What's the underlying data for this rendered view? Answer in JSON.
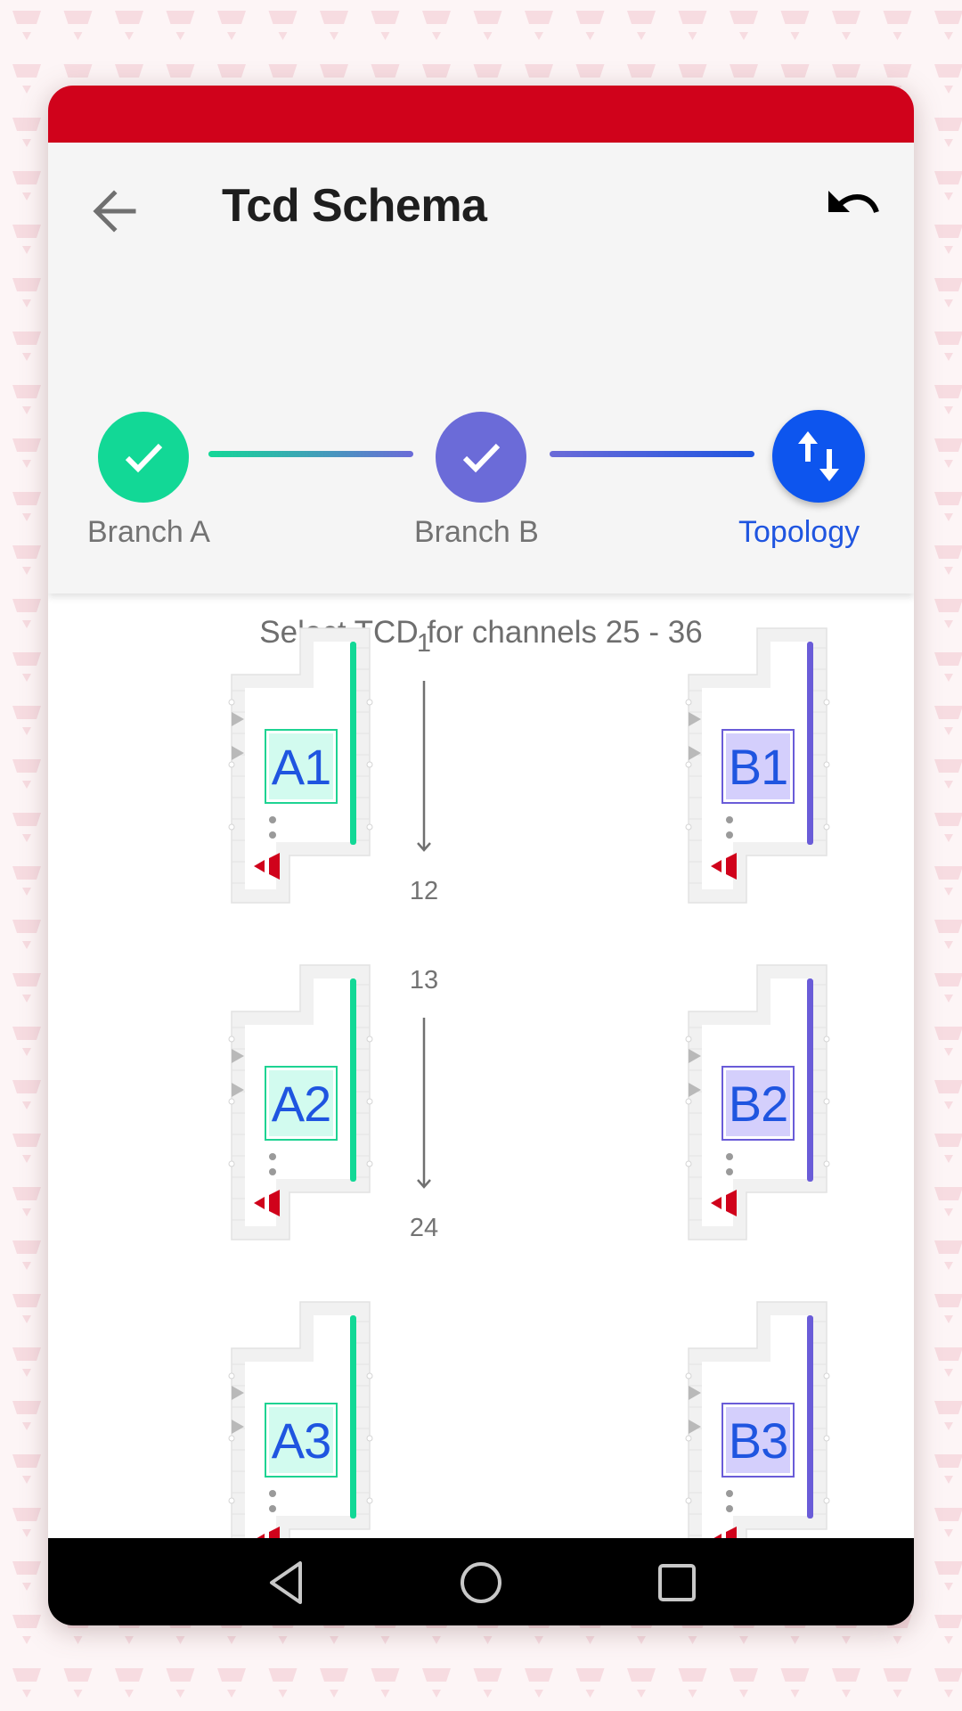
{
  "app": {
    "title": "Tcd Schema",
    "status_bar_color": "#d0021b"
  },
  "header": {
    "back_icon": "arrow-left-icon",
    "undo_icon": "undo-icon"
  },
  "stepper": {
    "steps": [
      {
        "label": "Branch A",
        "state": "completed",
        "icon": "check-icon",
        "color": "#12d896"
      },
      {
        "label": "Branch B",
        "state": "completed",
        "icon": "check-icon",
        "color": "#6b6bd8"
      },
      {
        "label": "Topology",
        "state": "active",
        "icon": "swap-vertical-icon",
        "color": "#0d55ee"
      }
    ]
  },
  "content": {
    "subtitle": "Select TCD for channels 25 - 36",
    "branch_a_color": "#12d896",
    "branch_b_color": "#6a5cd8",
    "tcds": {
      "a": [
        {
          "label": "A1"
        },
        {
          "label": "A2"
        },
        {
          "label": "A3"
        }
      ],
      "b": [
        {
          "label": "B1"
        },
        {
          "label": "B2"
        },
        {
          "label": "B3"
        }
      ]
    },
    "ranges": [
      {
        "start": "1",
        "end": "12"
      },
      {
        "start": "13",
        "end": "24"
      }
    ]
  },
  "nav_bar": {
    "back": "nav-back-icon",
    "home": "nav-home-icon",
    "recents": "nav-recents-icon"
  }
}
